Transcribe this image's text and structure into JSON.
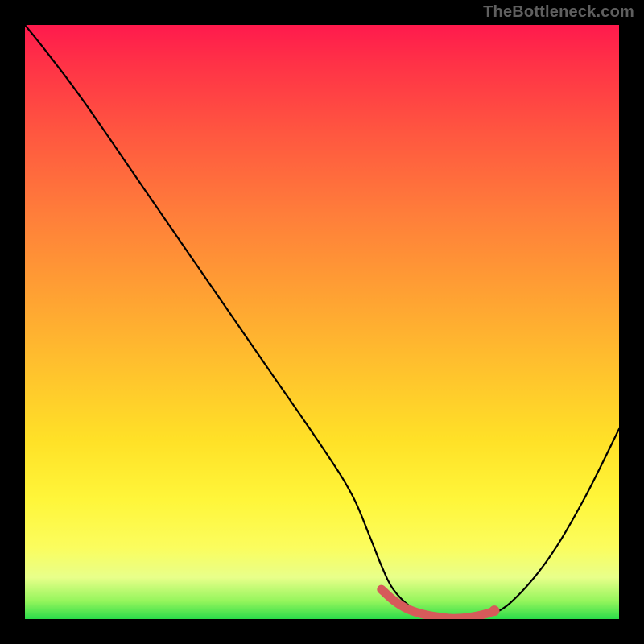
{
  "watermark": "TheBottleneck.com",
  "colors": {
    "frame": "#000000",
    "gradient_top": "#ff1a4d",
    "gradient_bottom": "#2bdc4a",
    "curve": "#000000",
    "marker": "#d65a5a"
  },
  "chart_data": {
    "type": "line",
    "title": "",
    "xlabel": "",
    "ylabel": "",
    "xlim": [
      0,
      100
    ],
    "ylim": [
      0,
      100
    ],
    "series": [
      {
        "name": "bottleneck-curve",
        "x": [
          0,
          4,
          10,
          20,
          30,
          40,
          50,
          55,
          58,
          60,
          62,
          65,
          68,
          72,
          76,
          78,
          82,
          88,
          94,
          100
        ],
        "y": [
          100,
          95,
          87,
          72.5,
          58,
          43.5,
          29,
          21,
          14,
          9,
          5,
          2,
          0.6,
          0,
          0,
          0.6,
          3,
          10,
          20,
          32
        ],
        "note": "Black curve; y is bottleneck percentage (100 = top of gradient, 0 = bottom). Minimum plateau ≈ x 68–78."
      },
      {
        "name": "optimal-range-marker",
        "x": [
          60,
          62,
          64,
          66,
          68,
          70,
          72,
          74,
          76,
          78,
          79
        ],
        "y": [
          5.0,
          3.2,
          1.9,
          1.1,
          0.6,
          0.3,
          0.1,
          0.2,
          0.5,
          1.0,
          1.4
        ],
        "note": "Thick salmon overlay hugging the curve bottom; small round cap near x≈79."
      }
    ],
    "annotations": []
  }
}
